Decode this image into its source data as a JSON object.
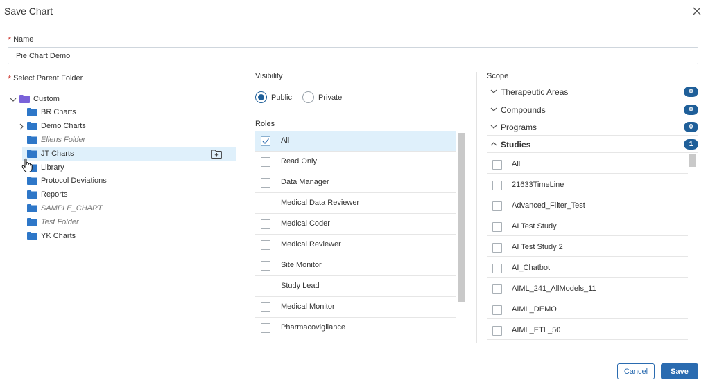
{
  "dialog": {
    "title": "Save Chart"
  },
  "name": {
    "label": "Name",
    "value": "Pie Chart Demo"
  },
  "folders": {
    "label": "Select Parent Folder",
    "items": [
      {
        "label": "Custom",
        "expanded": true,
        "level": 0
      },
      {
        "label": "BR Charts",
        "level": 1
      },
      {
        "label": "Demo Charts",
        "level": 1,
        "collapsed": true
      },
      {
        "label": "Ellens Folder",
        "level": 1,
        "italic": true
      },
      {
        "label": "JT Charts",
        "level": 1,
        "selected": true
      },
      {
        "label": "Library",
        "level": 1
      },
      {
        "label": "Protocol Deviations",
        "level": 1
      },
      {
        "label": "Reports",
        "level": 1
      },
      {
        "label": "SAMPLE_CHART",
        "level": 1,
        "italic": true
      },
      {
        "label": "Test Folder",
        "level": 1,
        "italic": true
      },
      {
        "label": "YK Charts",
        "level": 1
      }
    ]
  },
  "visibility": {
    "label": "Visibility",
    "options": [
      {
        "label": "Public",
        "selected": true
      },
      {
        "label": "Private",
        "selected": false
      }
    ]
  },
  "roles": {
    "label": "Roles",
    "items": [
      {
        "label": "All",
        "checked": true
      },
      {
        "label": "Read Only",
        "checked": false
      },
      {
        "label": "Data Manager",
        "checked": false
      },
      {
        "label": "Medical Data Reviewer",
        "checked": false
      },
      {
        "label": "Medical Coder",
        "checked": false
      },
      {
        "label": "Medical Reviewer",
        "checked": false
      },
      {
        "label": "Site Monitor",
        "checked": false
      },
      {
        "label": "Study Lead",
        "checked": false
      },
      {
        "label": "Medical Monitor",
        "checked": false
      },
      {
        "label": "Pharmacovigilance",
        "checked": false
      }
    ]
  },
  "scope": {
    "label": "Scope",
    "sections": [
      {
        "label": "Therapeutic Areas",
        "count": "0",
        "expanded": false
      },
      {
        "label": "Compounds",
        "count": "0",
        "expanded": false
      },
      {
        "label": "Programs",
        "count": "0",
        "expanded": false
      },
      {
        "label": "Studies",
        "count": "1",
        "expanded": true
      }
    ],
    "studies": [
      "All",
      "21633TimeLine",
      "Advanced_Filter_Test",
      "AI Test Study",
      "AI Test Study 2",
      "AI_Chatbot",
      "AIML_241_AllModels_11",
      "AIML_DEMO",
      "AIML_ETL_50"
    ]
  },
  "footer": {
    "cancel_label": "Cancel",
    "save_label": "Save"
  },
  "colors": {
    "accent": "#2a6bb0",
    "badge": "#1f5f99",
    "folder": "#2e77c8",
    "root_folder": "#7a62d9",
    "selected_row": "#dff0fb"
  }
}
